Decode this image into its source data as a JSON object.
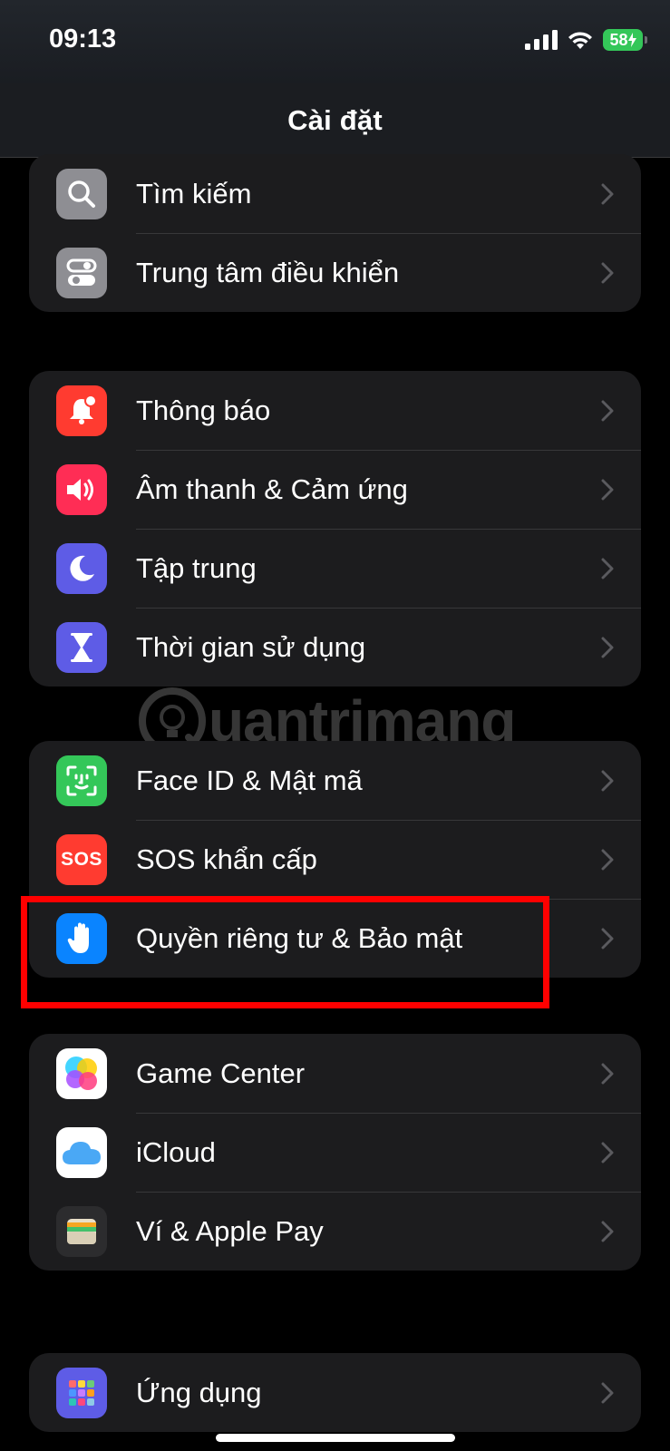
{
  "status": {
    "time": "09:13",
    "battery": "58"
  },
  "nav": {
    "title": "Cài đặt"
  },
  "groups": [
    {
      "items": [
        {
          "label": "Tìm kiếm",
          "icon": "search-icon"
        },
        {
          "label": "Trung tâm điều khiển",
          "icon": "control-center-icon"
        }
      ]
    },
    {
      "items": [
        {
          "label": "Thông báo",
          "icon": "notifications-icon"
        },
        {
          "label": "Âm thanh & Cảm ứng",
          "icon": "sound-icon"
        },
        {
          "label": "Tập trung",
          "icon": "focus-moon-icon"
        },
        {
          "label": "Thời gian sử dụng",
          "icon": "hourglass-icon"
        }
      ]
    },
    {
      "items": [
        {
          "label": "Face ID & Mật mã",
          "icon": "face-id-icon"
        },
        {
          "label": "SOS khẩn cấp",
          "icon": "sos-icon",
          "badge": "SOS"
        },
        {
          "label": "Quyền riêng tư & Bảo mật",
          "icon": "privacy-hand-icon"
        }
      ]
    },
    {
      "items": [
        {
          "label": "Game Center",
          "icon": "game-center-icon"
        },
        {
          "label": "iCloud",
          "icon": "icloud-icon"
        },
        {
          "label": "Ví & Apple Pay",
          "icon": "wallet-icon"
        }
      ]
    },
    {
      "items": [
        {
          "label": "Ứng dụng",
          "icon": "apps-icon"
        }
      ]
    }
  ],
  "watermark": {
    "text": "uantrimang"
  },
  "colors": {
    "background": "#000000",
    "cell": "#1c1c1e",
    "highlight": "#ff0000"
  }
}
